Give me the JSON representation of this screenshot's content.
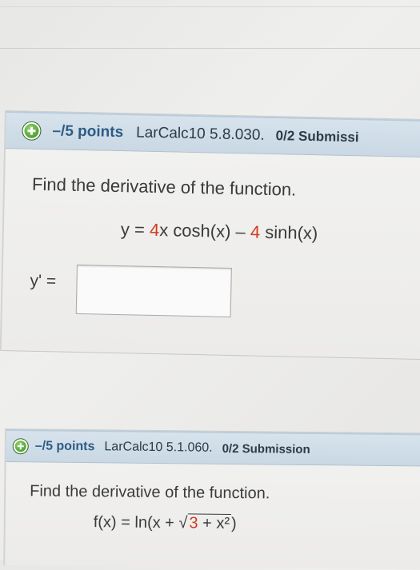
{
  "questions": [
    {
      "points": "–/5 points",
      "code": "LarCalc10 5.8.030.",
      "submissions": "0/2 Submissi",
      "prompt": "Find the derivative of the function.",
      "equation": {
        "lhs": "y = ",
        "coef1": "4",
        "term1": "x cosh(x) – ",
        "coef2": "4",
        "term2": " sinh(x)"
      },
      "answer_label": "y' =",
      "answer_value": ""
    },
    {
      "points": "–/5 points",
      "code": "LarCalc10 5.1.060.",
      "submissions": "0/2 Submission",
      "prompt": "Find the derivative of the function.",
      "equation": {
        "lhs": "f(x) = ln(x + ",
        "sqrt_sign": "√",
        "radicand_num": "3",
        "radicand_rest": " + x²",
        "close": ")"
      }
    }
  ],
  "icons": {
    "expand": "plus-icon"
  },
  "colors": {
    "header": "#c9d8e4",
    "points_text": "#2d5c85",
    "highlight_red": "#d23a1f",
    "icon_green": "#4a9a2e"
  }
}
